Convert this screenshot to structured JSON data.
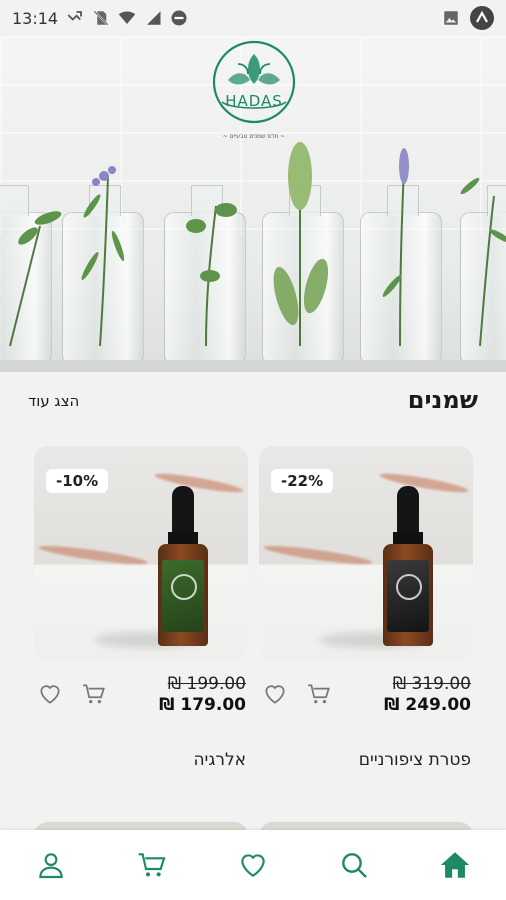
{
  "status_bar": {
    "time": "13:14",
    "icons": [
      "missed-call-icon",
      "no-sim-icon",
      "wifi-icon",
      "signal-icon",
      "do-not-disturb-icon",
      "image-icon",
      "app-badge-icon"
    ]
  },
  "brand": {
    "name": "HADAS",
    "tagline": "~ חדס שמנים טבעיים ~",
    "accent_color": "#1c8a66"
  },
  "section": {
    "title": "שמנים",
    "show_more": "הצג עוד"
  },
  "products": [
    {
      "name": "פטרת ציפורניים",
      "discount": "-22%",
      "old_price": "₪ 319.00",
      "new_price": "₪ 249.00",
      "label_style": "dark"
    },
    {
      "name": "אלרגיה",
      "discount": "-10%",
      "old_price": "₪ 199.00",
      "new_price": "₪ 179.00",
      "label_style": "green"
    }
  ],
  "bottom_nav": [
    {
      "name": "home",
      "icon": "home-icon",
      "active": true
    },
    {
      "name": "search",
      "icon": "search-icon",
      "active": false
    },
    {
      "name": "favorites",
      "icon": "heart-icon",
      "active": false
    },
    {
      "name": "cart",
      "icon": "cart-icon",
      "active": false
    },
    {
      "name": "profile",
      "icon": "user-icon",
      "active": false
    }
  ]
}
